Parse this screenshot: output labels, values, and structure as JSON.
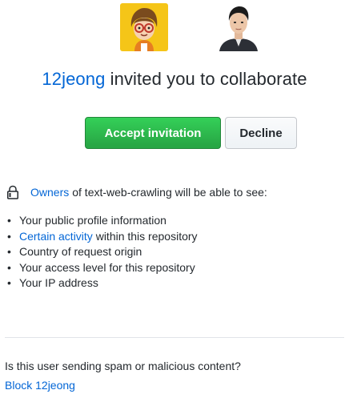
{
  "avatars": {
    "inviter_icon": "cartoon-avatar-icon",
    "invitee_icon": "profile-photo-icon",
    "inviter_bg": "#f5c518",
    "invitee_bg": "#ffffff"
  },
  "headline": {
    "user": "12jeong",
    "text": " invited you to collaborate"
  },
  "actions": {
    "accept_label": "Accept invitation",
    "decline_label": "Decline",
    "accept_color": "#28a745"
  },
  "permissions": {
    "owners_link": "Owners",
    "intro_rest": "of text-web-crawling will be able to see:",
    "items": [
      {
        "link": "",
        "text": "Your public profile information"
      },
      {
        "link": "Certain activity",
        "text": " within this repository"
      },
      {
        "link": "",
        "text": "Country of request origin"
      },
      {
        "link": "",
        "text": "Your access level for this repository"
      },
      {
        "link": "",
        "text": "Your IP address"
      }
    ]
  },
  "spam": {
    "question": "Is this user sending spam or malicious content?",
    "block_label": "Block 12jeong"
  },
  "colors": {
    "link": "#0366d6",
    "text": "#24292e",
    "divider": "#e1e4e8"
  }
}
